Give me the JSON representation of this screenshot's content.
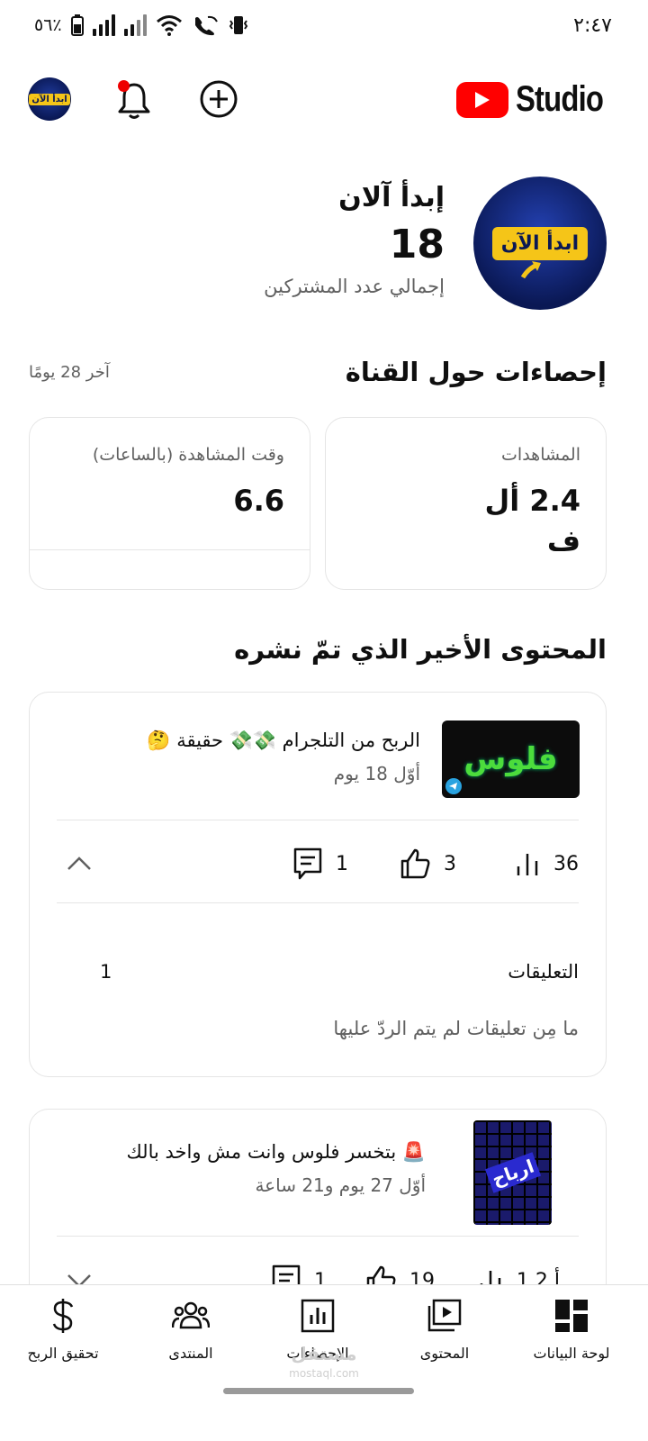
{
  "status_bar": {
    "battery": "٥٦٪",
    "time": "٢:٤٧"
  },
  "app": {
    "logo_word": "Studio",
    "channel_logo_text": "ابدأ الآن"
  },
  "channel": {
    "name": "إبدأ آلان",
    "subscribers": "18",
    "subscribers_label": "إجمالي عدد المشتركين"
  },
  "stats": {
    "title": "إحصاءات حول القناة",
    "period": "آخر 28 يومًا",
    "views_label": "المشاهدات",
    "views_value": "2.4 أل ف",
    "watch_label": "وقت المشاهدة (بالساعات)",
    "watch_value": "6.6"
  },
  "recent": {
    "title": "المحتوى الأخير الذي تمّ نشره",
    "videos": [
      {
        "thumb_text": "فلوس",
        "title": "الربح من التلجرام 💸💸 حقيقة 🤔",
        "age": "أوّل 18 يوم",
        "views": "36",
        "likes": "3",
        "comments": "1",
        "comments_label": "التعليقات",
        "comments_count": "1",
        "unreplied_note": "ما مِن تعليقات لم يتم الردّ عليها"
      },
      {
        "thumb_text": "ارباح",
        "title": "🚨 بتخسر فلوس وانت مش واخد بالك",
        "age": "أوّل 27 يوم و21 ساعة",
        "views": "1.2 أ...",
        "likes": "19",
        "comments": "1"
      }
    ]
  },
  "bottom_nav": {
    "dashboard": "لوحة البيانات",
    "content": "المحتوى",
    "analytics": "الإحصاءات",
    "community": "المنتدى",
    "earn": "تحقيق الربح"
  },
  "watermark": {
    "arabic": "مستقل",
    "latin": "mostaql.com"
  }
}
